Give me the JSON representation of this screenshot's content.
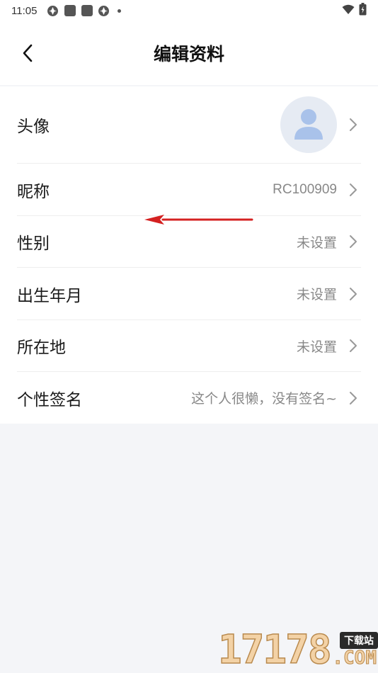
{
  "status_bar": {
    "time": "11:05",
    "left_icons": [
      "badge-icon",
      "app-square-icon",
      "app-square-icon",
      "badge-icon",
      "dot-icon"
    ],
    "right_icons": [
      "wifi-icon",
      "battery-icon"
    ]
  },
  "header": {
    "title": "编辑资料",
    "back_icon": "chevron-left-icon"
  },
  "profile": {
    "rows": [
      {
        "label": "头像",
        "value": "",
        "type": "avatar"
      },
      {
        "label": "昵称",
        "value": "RC100909"
      },
      {
        "label": "性别",
        "value": "未设置"
      },
      {
        "label": "出生年月",
        "value": "未设置"
      },
      {
        "label": "所在地",
        "value": "未设置"
      },
      {
        "label": "个性签名",
        "value": "这个人很懒，没有签名~"
      }
    ]
  },
  "colors": {
    "avatar_bg": "#e6ebf3",
    "avatar_figure": "#a9c2ea",
    "annotation_arrow": "#d42020"
  },
  "watermark": {
    "digits": "17178",
    "badge": "下载站",
    "suffix": ".COM"
  }
}
